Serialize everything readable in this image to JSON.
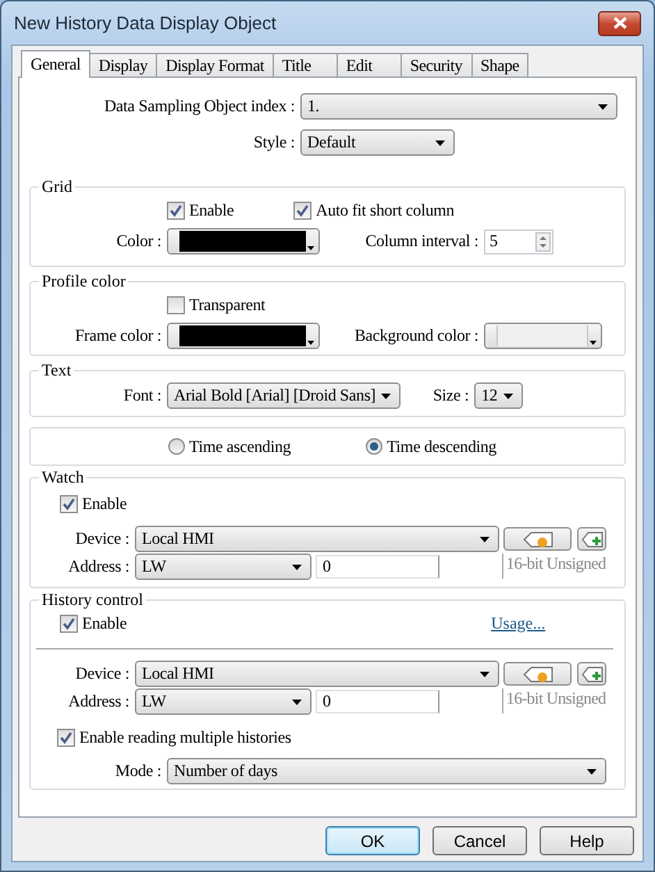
{
  "window": {
    "title": "New History Data Display Object"
  },
  "tabs": [
    {
      "label": "General",
      "selected": true
    },
    {
      "label": "Display",
      "selected": false
    },
    {
      "label": "Display Format",
      "selected": false
    },
    {
      "label": "Title",
      "selected": false
    },
    {
      "label": "Edit",
      "selected": false
    },
    {
      "label": "Security",
      "selected": false
    },
    {
      "label": "Shape",
      "selected": false
    }
  ],
  "general": {
    "sampling_index": {
      "label": "Data Sampling Object index :",
      "value": "1."
    },
    "style": {
      "label": "Style :",
      "value": "Default"
    }
  },
  "grid": {
    "title": "Grid",
    "enable": {
      "label": "Enable",
      "checked": true
    },
    "auto_fit": {
      "label": "Auto fit short column",
      "checked": true
    },
    "color": {
      "label": "Color :",
      "color": "#000000"
    },
    "column_interval": {
      "label": "Column interval :",
      "value": "5"
    }
  },
  "profile_color": {
    "title": "Profile color",
    "transparent": {
      "label": "Transparent",
      "checked": false
    },
    "frame_color": {
      "label": "Frame color :",
      "color": "#000000"
    },
    "background_color": {
      "label": "Background color :",
      "color": "#f0f0f0"
    }
  },
  "text": {
    "title": "Text",
    "font": {
      "label": "Font :",
      "value": "Arial Bold [Arial] [Droid Sans]"
    },
    "size": {
      "label": "Size :",
      "value": "12"
    }
  },
  "order": [
    {
      "label": "Time ascending",
      "selected": false
    },
    {
      "label": "Time descending",
      "selected": true
    }
  ],
  "watch": {
    "title": "Watch",
    "enable": {
      "label": "Enable",
      "checked": true
    },
    "device": {
      "label": "Device :",
      "value": "Local HMI"
    },
    "address": {
      "label": "Address :",
      "type": "LW",
      "value": "0"
    },
    "format": "16-bit Unsigned"
  },
  "history_control": {
    "title": "History control",
    "enable": {
      "label": "Enable",
      "checked": true
    },
    "usage_link": "Usage...",
    "device": {
      "label": "Device :",
      "value": "Local HMI"
    },
    "address": {
      "label": "Address :",
      "type": "LW",
      "value": "0"
    },
    "format": "16-bit Unsigned",
    "multiple": {
      "label": "Enable reading multiple histories",
      "checked": true
    },
    "mode": {
      "label": "Mode :",
      "value": "Number of days"
    }
  },
  "buttons": [
    {
      "label": "OK",
      "default": true
    },
    {
      "label": "Cancel",
      "default": false
    },
    {
      "label": "Help",
      "default": false
    }
  ]
}
